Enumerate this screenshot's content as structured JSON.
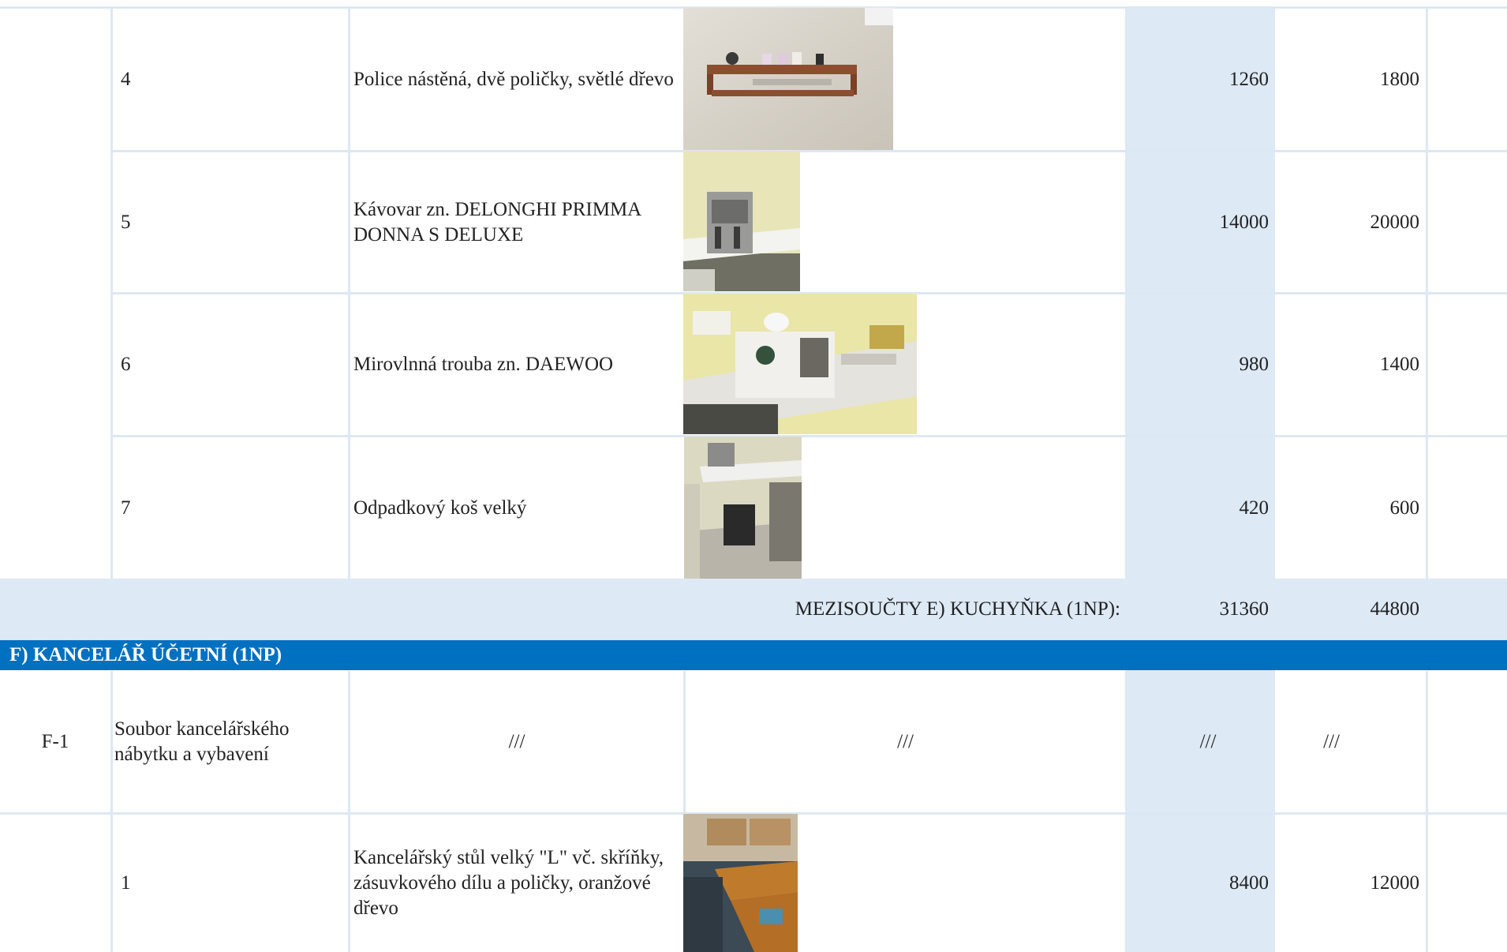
{
  "rows": [
    {
      "num": "4",
      "desc": "Police nástěná, dvě poličky, světlé dřevo",
      "v1": "1260",
      "v2": "1800",
      "photo_icon": "wall-shelf-photo"
    },
    {
      "num": "5",
      "desc": "Kávovar zn. DELONGHI PRIMMA DONNA S DELUXE",
      "v1": "14000",
      "v2": "20000",
      "photo_icon": "coffee-machine-photo"
    },
    {
      "num": "6",
      "desc": "Mirovlnná trouba zn. DAEWOO",
      "v1": "980",
      "v2": "1400",
      "photo_icon": "microwave-photo"
    },
    {
      "num": "7",
      "desc": "Odpadkový koš velký",
      "v1": "420",
      "v2": "600",
      "photo_icon": "waste-bin-photo"
    }
  ],
  "subtotal": {
    "label": "MEZISOUČTY E) KUCHYŇKA (1NP):",
    "v1": "31360",
    "v2": "44800"
  },
  "section_f": {
    "title": "F) KANCELÁŘ ÚČETNÍ (1NP)"
  },
  "group_f1": {
    "code": "F-1",
    "desc": "Soubor kancelářského nábytku a vybavení",
    "c3": "///",
    "c4": "///",
    "c5": "///",
    "c6": "///"
  },
  "row_f1_1": {
    "num": "1",
    "desc": "Kancelářský stůl velký \"L\" vč. skříňky, zásuvkového dílu a poličky, oranžové dřevo",
    "v1": "8400",
    "v2": "12000",
    "photo_icon": "office-desk-photo"
  },
  "colors": {
    "section_bar": "#0070c0",
    "subtotal_bg": "#dde9f5",
    "grid_line": "#dde8f3"
  }
}
